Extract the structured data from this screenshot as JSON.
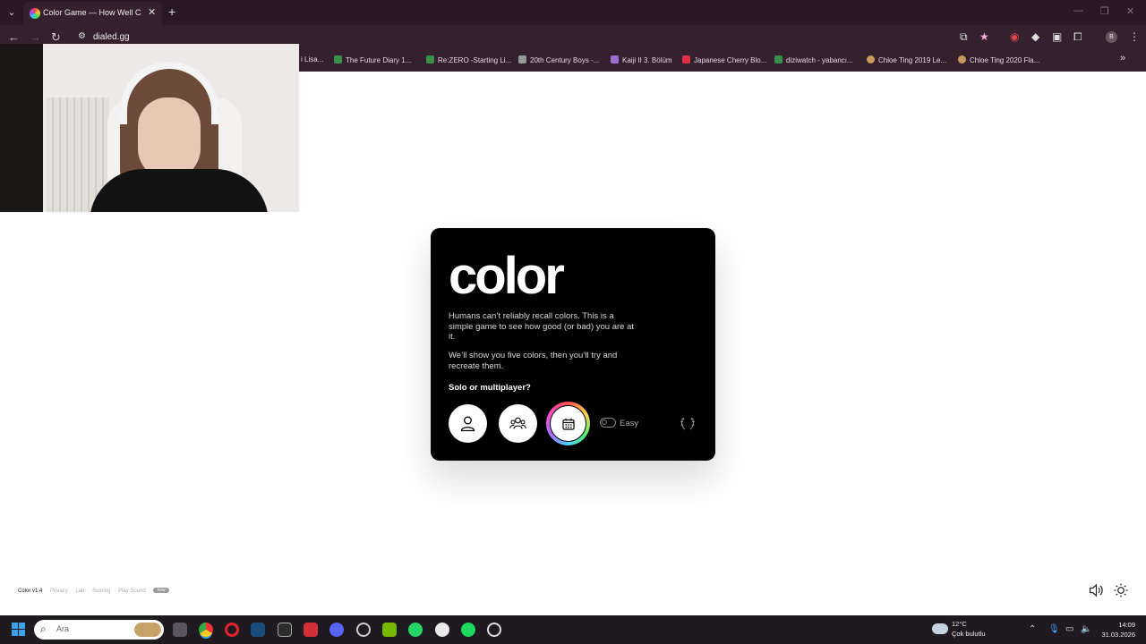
{
  "browser": {
    "tab_title": "Color Game — How Well Can V",
    "url": "dialed.gg",
    "bookmarks": [
      {
        "label": "i Lisa...",
        "color": "#777777"
      },
      {
        "label": "The Future Diary 1...",
        "color": "#3a8f4a"
      },
      {
        "label": "Re:ZERO -Starting Li...",
        "color": "#3a8f4a"
      },
      {
        "label": "20th Century Boys -...",
        "color": "#999999"
      },
      {
        "label": "Kaiji II 3. Bölüm",
        "color": "#9a6fd0"
      },
      {
        "label": "Japanese Cherry Blo...",
        "color": "#e0304a"
      },
      {
        "label": "diziwatch - yabancı...",
        "color": "#3a8f4a"
      },
      {
        "label": "Chloe Ting 2019 Le...",
        "color": "#c89a60"
      },
      {
        "label": "Chloe Ting 2020 Fla...",
        "color": "#c89a60"
      }
    ]
  },
  "game": {
    "logo": "color",
    "intro_1": "Humans can’t reliably recall colors. This is a simple game to see how good (or bad) you are at it.",
    "intro_2": "We’ll show you five colors, then you’ll try and recreate them.",
    "question": "Solo or multiplayer?",
    "mode_toggle_label": "Easy"
  },
  "footer": {
    "version": "Color v1.4",
    "privacy": "Privacy",
    "lab": "Lab",
    "scoring": "Scoring",
    "play_sound": "Play Sound",
    "badge": "new"
  },
  "taskbar": {
    "search_placeholder": "Ara",
    "temperature": "12°C",
    "weather": "Çok bulutlu",
    "time": "14:09",
    "date": "31.03.2026"
  },
  "colors": {
    "chrome_bg": "#35202e",
    "card_bg": "#000000",
    "accent_bookmark_star": "#f0b0dc"
  }
}
